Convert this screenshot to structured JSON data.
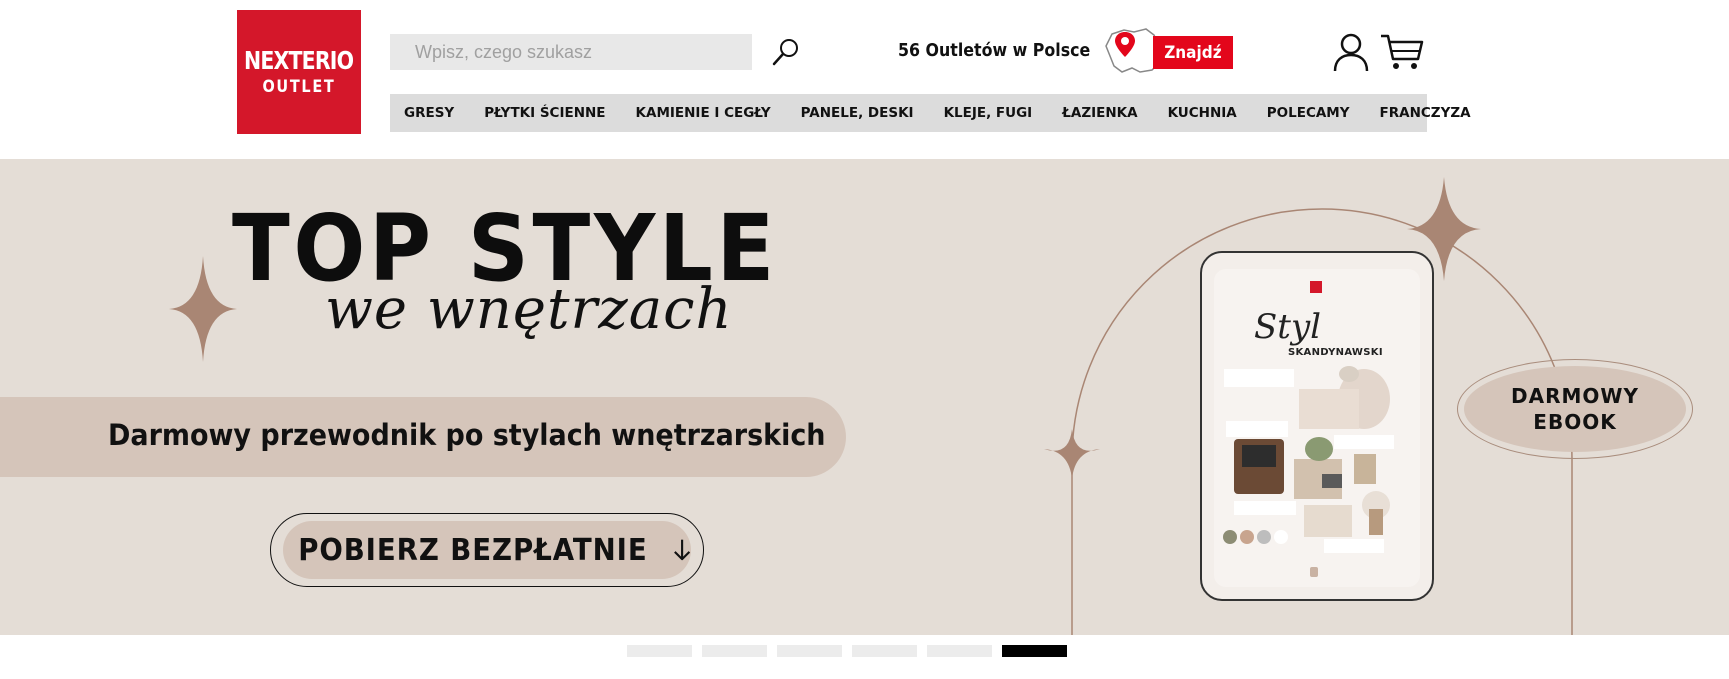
{
  "logo": {
    "line1": "NEXTERIO",
    "line2": "OUTLET"
  },
  "search": {
    "placeholder": "Wpisz, czego szukasz",
    "value": ""
  },
  "outlets": {
    "text": "56 Outletów w Polsce",
    "button": "Znajdź"
  },
  "nav": [
    {
      "label": "GRESY"
    },
    {
      "label": "PŁYTKI ŚCIENNE"
    },
    {
      "label": "KAMIENIE I CEGŁY"
    },
    {
      "label": "PANELE, DESKI"
    },
    {
      "label": "KLEJE, FUGI"
    },
    {
      "label": "ŁAZIENKA"
    },
    {
      "label": "KUCHNIA"
    },
    {
      "label": "POLECAMY"
    },
    {
      "label": "FRANCZYZA"
    }
  ],
  "banner": {
    "headline": "TOP STYLE",
    "script": "we wnętrzach",
    "subtitle": "Darmowy przewodnik po stylach wnętrzarskich",
    "cta": "POBIERZ BEZPŁATNIE",
    "badge_line1": "DARMOWY",
    "badge_line2": "EBOOK",
    "tablet_title": "Styl",
    "tablet_subtitle": "SKANDYNAWSKI"
  },
  "slider": {
    "count": 6,
    "active_index": 5
  },
  "colors": {
    "brand_red": "#d4172a",
    "find_red": "#e3061b",
    "banner_bg": "#e4ddd6",
    "accent_beige": "#d5c5ba",
    "star_brown": "#a98674"
  }
}
